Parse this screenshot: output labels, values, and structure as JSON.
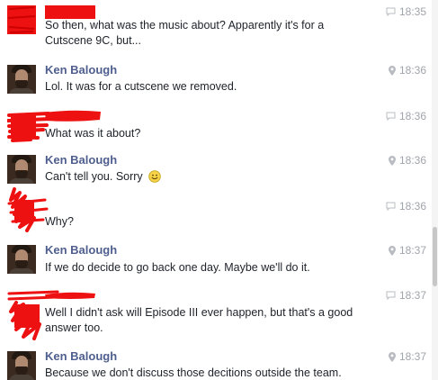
{
  "messages": [
    {
      "sender": "",
      "text": "So then, what was the music about? Apparently it's for a Cutscene 9C, but...",
      "time": "18:35",
      "icon": "chat-bubble-icon"
    },
    {
      "sender": "Ken Balough",
      "text": "Lol. It was for a cutscene we removed.",
      "time": "18:36",
      "icon": "location-pin-icon"
    },
    {
      "sender": "",
      "text": "What was it about?",
      "time": "18:36",
      "icon": "chat-bubble-icon"
    },
    {
      "sender": "Ken Balough",
      "text": "Can't tell you. Sorry",
      "time": "18:36",
      "icon": "location-pin-icon"
    },
    {
      "sender": "",
      "text": "Why?",
      "time": "18:36",
      "icon": "chat-bubble-icon"
    },
    {
      "sender": "Ken Balough",
      "text": "If we do decide to go back one day. Maybe we'll do it.",
      "time": "18:37",
      "icon": "location-pin-icon"
    },
    {
      "sender": "",
      "text": "Well I didn't ask will Episode III ever happen, but that's a good answer too.",
      "time": "18:37",
      "icon": "chat-bubble-icon"
    },
    {
      "sender": "Ken Balough",
      "text": "Because we don't discuss those decitions outside the team.",
      "time": "18:37",
      "icon": "location-pin-icon"
    }
  ],
  "colors": {
    "sender_name": "#4e5e8e",
    "message_text": "#1d2129",
    "timestamp": "#a0a4ab",
    "redaction": "#ee1111"
  }
}
